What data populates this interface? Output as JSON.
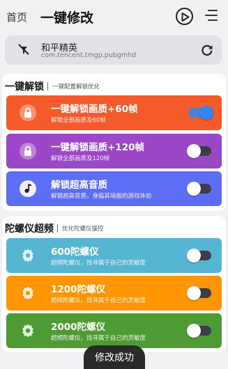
{
  "header": {
    "nav_home": "首页",
    "title": "一键修改",
    "play_icon": "play-icon",
    "menu_icon": "menu-icon"
  },
  "app_bar": {
    "icon": "app-off-icon",
    "name": "和平精英",
    "package": "com.tencent.tmgp.pubgmhd",
    "refresh_icon": "refresh-icon"
  },
  "sections": [
    {
      "title": "一键解锁",
      "subtitle": "一键配置解锁优化",
      "rows": [
        {
          "title": "一键解锁画质+60帧",
          "desc": "解锁全部画质及60帧",
          "color": "#f55a2a",
          "icon": "lock-icon",
          "enabled": true
        },
        {
          "title": "一键解锁画质+120帧",
          "desc": "解锁全部画质及120帧",
          "color": "#9a48c8",
          "icon": "lock-icon",
          "enabled": false
        },
        {
          "title": "解锁超高音质",
          "desc": "解锁超高音质，身临其境般的游戏体验",
          "color": "#5b6ef5",
          "icon": "music-icon",
          "enabled": false
        }
      ]
    },
    {
      "title": "陀螺仪超频",
      "subtitle": "优化陀螺仪操控",
      "rows": [
        {
          "title": "600陀螺仪",
          "desc": "超频陀螺仪，找寻属于自己的灵敏度",
          "color": "#56b5d0",
          "icon": "gear-icon",
          "enabled": false
        },
        {
          "title": "1200陀螺仪",
          "desc": "超频陀螺仪，找寻属于自己的灵敏度",
          "color": "#ff9500",
          "icon": "gear-icon",
          "enabled": false
        },
        {
          "title": "2000陀螺仪",
          "desc": "超频陀螺仪，找寻属于自己的灵敏度",
          "color": "#4e9b35",
          "icon": "gear-icon",
          "enabled": false
        }
      ]
    }
  ],
  "toast": "修改成功"
}
